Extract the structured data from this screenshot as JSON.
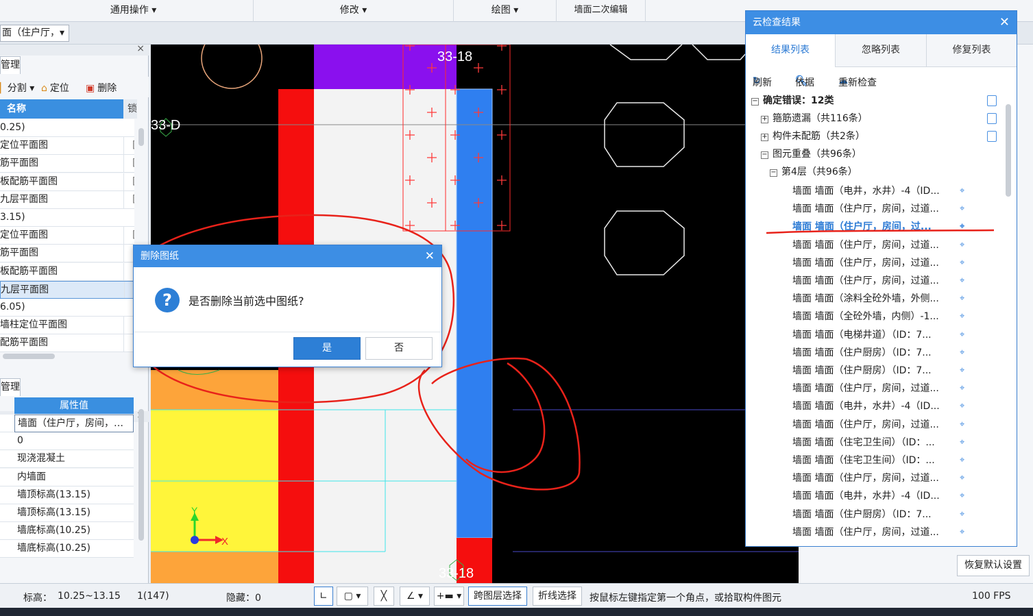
{
  "toolbar": {
    "groups": [
      "通用操作 ▾",
      "修改 ▾",
      "绘图 ▾",
      "墙面二次编辑"
    ]
  },
  "filter_combo": "面（住户厅，▾",
  "left_panel": {
    "top_tab": "管理",
    "tools": [
      "分割 ▾",
      "定位",
      "删除"
    ],
    "col_name": "名称",
    "col_lock": "锁",
    "rows": [
      {
        "name": "0.25)",
        "lock": ""
      },
      {
        "name": "定位平面图",
        "lock": "["
      },
      {
        "name": "筋平面图",
        "lock": "["
      },
      {
        "name": "板配筋平面图",
        "lock": "["
      },
      {
        "name": "九层平面图",
        "lock": "["
      },
      {
        "name": "3.15)",
        "lock": ""
      },
      {
        "name": "定位平面图",
        "lock": "["
      },
      {
        "name": "筋平面图",
        "lock": "["
      },
      {
        "name": "板配筋平面图",
        "lock": "["
      },
      {
        "name": "九层平面图",
        "lock": "["
      },
      {
        "name": "6.05)",
        "lock": ""
      },
      {
        "name": "墙柱定位平面图",
        "lock": "["
      },
      {
        "name": "配筋平面图",
        "lock": "["
      }
    ],
    "bottom_tab": "管理",
    "prop_header": "属性值",
    "props": [
      "墙面（住户厅，房间，…",
      "0",
      "现浇混凝土",
      "内墙面",
      "墙顶标高(13.15)",
      "墙顶标高(13.15)",
      "墙底标高(10.25)",
      "墙底标高(10.25)"
    ]
  },
  "canvas": {
    "labels": [
      "33-18",
      "33-D",
      "33-18"
    ],
    "axis_y": "Y",
    "axis_x": "X"
  },
  "cloud_panel": {
    "title": "云检查结果",
    "close": "✕",
    "tabs": [
      "结果列表",
      "忽略列表",
      "修复列表"
    ],
    "tools": {
      "refresh": "刷新",
      "basis": "依据",
      "recheck": "重新检查"
    },
    "root": "确定错误：12类",
    "groups": [
      {
        "sign": "+",
        "label": "箍筋遗漏（共116条）"
      },
      {
        "sign": "+",
        "label": "构件未配筋（共2条）"
      },
      {
        "sign": "−",
        "label": "图元重叠（共96条）"
      }
    ],
    "floor": "第4层（共96条）",
    "items": [
      "墙面 墙面（电井，水井）-4（ID...",
      "墙面 墙面（住户厅，房间，过道...",
      "墙面 墙面（住户厅，房间，过...",
      "墙面 墙面（住户厅，房间，过道...",
      "墙面 墙面（住户厅，房间，过道...",
      "墙面 墙面（住户厅，房间，过道...",
      "墙面 墙面（涂料全砼外墙，外侧...",
      "墙面 墙面（全砼外墙，内侧）-1...",
      "墙面 墙面（电梯井道）（ID：7...",
      "墙面 墙面（住户厨房）（ID：7...",
      "墙面 墙面（住户厨房）（ID：7...",
      "墙面 墙面（住户厅，房间，过道...",
      "墙面 墙面（电井，水井）-4（ID...",
      "墙面 墙面（住户厅，房间，过道...",
      "墙面 墙面（住宅卫生间）（ID：...",
      "墙面 墙面（住宅卫生间）（ID：...",
      "墙面 墙面（住户厅，房间，过道...",
      "墙面 墙面（电井，水井）-4（ID...",
      "墙面 墙面（住户厨房）（ID：7...",
      "墙面 墙面（住户厅，房间，过道..."
    ],
    "highlighted_index": 2,
    "restore_button": "恢复默认设置"
  },
  "dialog": {
    "title": "删除图纸",
    "close": "✕",
    "icon": "?",
    "message": "是否删除当前选中图纸?",
    "yes": "是",
    "no": "否"
  },
  "status_bar": {
    "elev_label": "标高：",
    "elev_value": "10.25~13.15",
    "count": "1(147)",
    "hidden": "隐藏：0",
    "cross_layer": "跨图层选择",
    "polyline": "折线选择",
    "hint": "按鼠标左键指定第一个角点，或拾取构件图元",
    "fps": "100 FPS"
  },
  "colors": {
    "accent": "#3d8ee4",
    "annotation": "#e8221a",
    "wall_red": "#f50e0e",
    "wall_blue": "#2f7ff0",
    "purple": "#8a10ee",
    "yellow": "#fff53a",
    "orange": "#fda43a"
  }
}
